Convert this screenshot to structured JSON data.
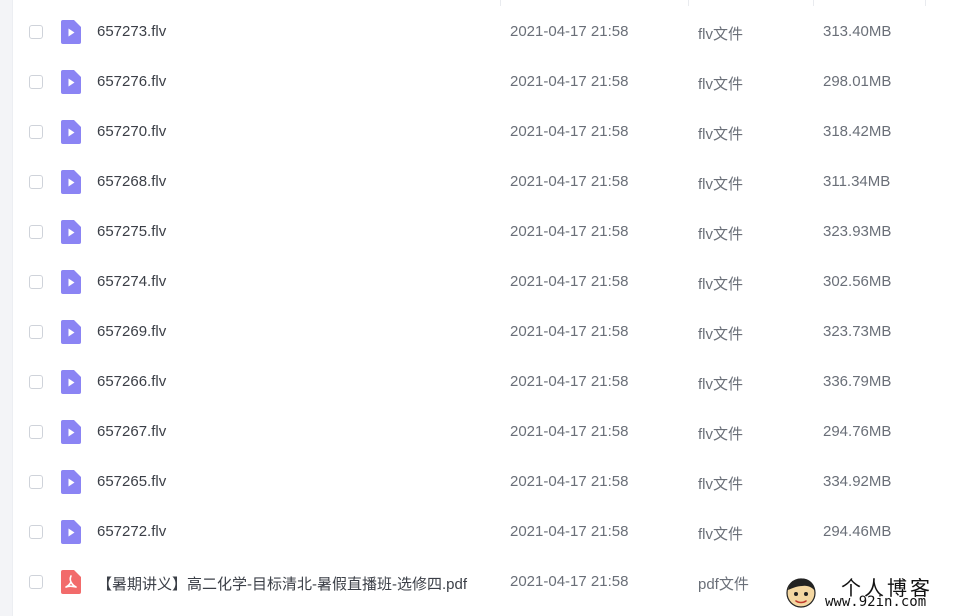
{
  "files": [
    {
      "name": "657273.flv",
      "date": "2021-04-17 21:58",
      "type": "flv文件",
      "size": "313.40MB",
      "icon": "video-file-icon"
    },
    {
      "name": "657276.flv",
      "date": "2021-04-17 21:58",
      "type": "flv文件",
      "size": "298.01MB",
      "icon": "video-file-icon"
    },
    {
      "name": "657270.flv",
      "date": "2021-04-17 21:58",
      "type": "flv文件",
      "size": "318.42MB",
      "icon": "video-file-icon"
    },
    {
      "name": "657268.flv",
      "date": "2021-04-17 21:58",
      "type": "flv文件",
      "size": "311.34MB",
      "icon": "video-file-icon"
    },
    {
      "name": "657275.flv",
      "date": "2021-04-17 21:58",
      "type": "flv文件",
      "size": "323.93MB",
      "icon": "video-file-icon"
    },
    {
      "name": "657274.flv",
      "date": "2021-04-17 21:58",
      "type": "flv文件",
      "size": "302.56MB",
      "icon": "video-file-icon"
    },
    {
      "name": "657269.flv",
      "date": "2021-04-17 21:58",
      "type": "flv文件",
      "size": "323.73MB",
      "icon": "video-file-icon"
    },
    {
      "name": "657266.flv",
      "date": "2021-04-17 21:58",
      "type": "flv文件",
      "size": "336.79MB",
      "icon": "video-file-icon"
    },
    {
      "name": "657267.flv",
      "date": "2021-04-17 21:58",
      "type": "flv文件",
      "size": "294.76MB",
      "icon": "video-file-icon"
    },
    {
      "name": "657265.flv",
      "date": "2021-04-17 21:58",
      "type": "flv文件",
      "size": "334.92MB",
      "icon": "video-file-icon"
    },
    {
      "name": "657272.flv",
      "date": "2021-04-17 21:58",
      "type": "flv文件",
      "size": "294.46MB",
      "icon": "video-file-icon"
    },
    {
      "name": "【暑期讲义】高二化学-目标清北-暑假直播班-选修四.pdf",
      "date": "2021-04-17 21:58",
      "type": "pdf文件",
      "size": "",
      "icon": "pdf-file-icon"
    }
  ],
  "colors": {
    "video_icon": "#8b84f4",
    "pdf_icon": "#f26b6b",
    "text_primary": "#3b3f47",
    "text_secondary": "#6a6f78"
  },
  "watermark": {
    "title": "个人博客",
    "url": "www.92in.com"
  }
}
